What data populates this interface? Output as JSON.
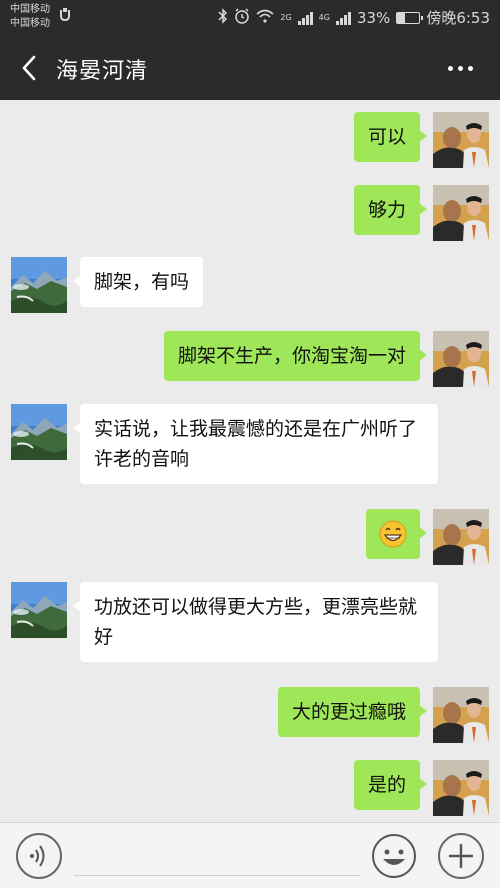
{
  "status_bar": {
    "carrier_1": "中国移动",
    "carrier_2": "中国移动",
    "net_1": "2G",
    "net_2": "4G",
    "battery": "33%",
    "battery_level": 0.33,
    "time": "傍晚6:53"
  },
  "header": {
    "title": "海晏河清"
  },
  "messages": [
    {
      "side": "right",
      "text": "可以"
    },
    {
      "side": "right",
      "text": "够力"
    },
    {
      "side": "left",
      "text": "脚架，有吗"
    },
    {
      "side": "right",
      "text": "脚架不生产，你淘宝淘一对"
    },
    {
      "side": "left",
      "text": "实话说，让我最震憾的还是在广州听了许老的音响"
    },
    {
      "side": "right",
      "text": "",
      "emoji": "grinning-face"
    },
    {
      "side": "left",
      "text": "功放还可以做得更大方些，更漂亮些就好"
    },
    {
      "side": "right",
      "text": "大的更过瘾哦"
    },
    {
      "side": "right",
      "text": "是的"
    }
  ],
  "colors": {
    "header_bg": "#2b2b2b",
    "chat_bg": "#ebebeb",
    "sent_bubble": "#9fe658",
    "received_bubble": "#ffffff"
  },
  "input_bar": {
    "voice_icon": "voice-icon",
    "emoji_icon": "emoji-icon",
    "plus_icon": "plus-icon"
  }
}
